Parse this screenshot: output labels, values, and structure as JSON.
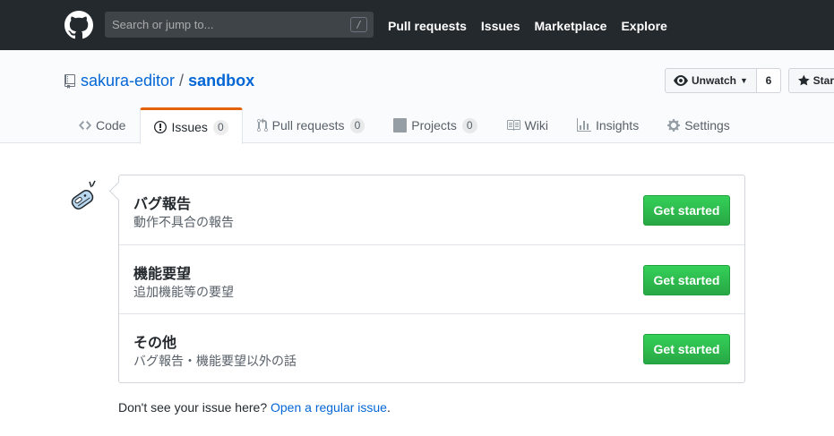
{
  "header": {
    "search_placeholder": "Search or jump to...",
    "search_key": "/",
    "nav": [
      "Pull requests",
      "Issues",
      "Marketplace",
      "Explore"
    ]
  },
  "repo": {
    "owner": "sakura-editor",
    "separator": "/",
    "name": "sandbox",
    "watch_label": "Unwatch",
    "watch_count": "6",
    "star_label": "Star"
  },
  "tabs": [
    {
      "label": "Code",
      "icon": "code-icon"
    },
    {
      "label": "Issues",
      "count": "0",
      "icon": "issue-opened-icon"
    },
    {
      "label": "Pull requests",
      "count": "0",
      "icon": "git-pull-request-icon"
    },
    {
      "label": "Projects",
      "count": "0",
      "icon": "project-icon"
    },
    {
      "label": "Wiki",
      "icon": "book-icon"
    },
    {
      "label": "Insights",
      "icon": "graph-icon"
    },
    {
      "label": "Settings",
      "icon": "gear-icon"
    }
  ],
  "templates": [
    {
      "name": "バグ報告",
      "description": "動作不具合の報告",
      "button": "Get started"
    },
    {
      "name": "機能要望",
      "description": "追加機能等の要望",
      "button": "Get started"
    },
    {
      "name": "その他",
      "description": "バグ報告・機能要望以外の話",
      "button": "Get started"
    }
  ],
  "footer": {
    "prefix": "Don't see your issue here?",
    "link": "Open a regular issue",
    "suffix": "."
  },
  "colors": {
    "header_bg": "#24292e",
    "link": "#0366d6",
    "tab_accent": "#e36209",
    "button_green": "#28a745"
  }
}
